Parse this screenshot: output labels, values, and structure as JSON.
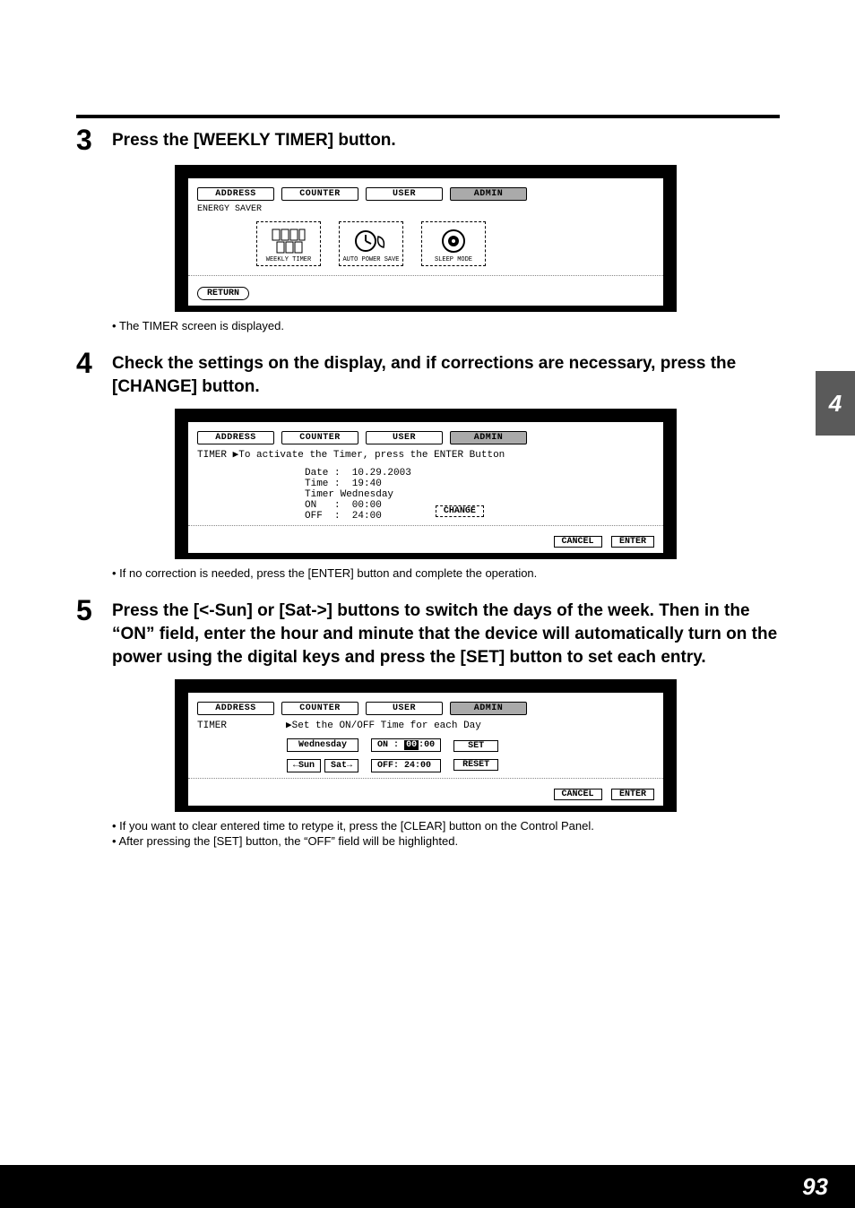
{
  "page_number": "93",
  "side_tab": "4",
  "steps": {
    "s3": {
      "num": "3",
      "title": "Press the [WEEKLY TIMER] button.",
      "bullet1": "The TIMER screen is displayed."
    },
    "s4": {
      "num": "4",
      "title": "Check the settings on the display, and if corrections are necessary, press the [CHANGE] button.",
      "bullet1": "If no correction is needed, press the [ENTER] button and complete the operation."
    },
    "s5": {
      "num": "5",
      "title": "Press the [<-Sun] or [Sat->] buttons to switch the days of the week. Then in the “ON” field, enter the hour and minute that the device will automatically turn on the power using the digital keys and press the [SET] button to set each entry.",
      "bullet1": "If you want to clear entered time to retype it, press the [CLEAR] button on the Control Panel.",
      "bullet2": "After pressing the [SET] button, the “OFF” field will be highlighted."
    }
  },
  "lcd_tabs": {
    "address": "ADDRESS",
    "counter": "COUNTER",
    "user": "USER",
    "admin": "ADMIN"
  },
  "lcd1": {
    "breadcrumb": "ENERGY SAVER",
    "icon1": "WEEKLY TIMER",
    "icon2": "AUTO POWER SAVE",
    "icon3": "SLEEP MODE",
    "return": "RETURN"
  },
  "lcd2": {
    "breadcrumb": "TIMER  ▶To activate the Timer, press the ENTER Button",
    "date_lbl": "Date :  10.29.2003",
    "time_lbl": "Time :  19:40",
    "timer_day": "Timer Wednesday",
    "on": "ON   :  00:00",
    "off": "OFF  :  24:00",
    "change": "CHANGE",
    "cancel": "CANCEL",
    "enter": "ENTER"
  },
  "lcd3": {
    "breadcrumb": "TIMER          ▶Set the ON/OFF Time for each Day",
    "day": "Wednesday",
    "on_label": "ON :",
    "on_hh": "00",
    "on_rest": ":00",
    "off": "OFF: 24:00",
    "sun": "←Sun",
    "sat": "Sat→",
    "set": "SET",
    "reset": "RESET",
    "cancel": "CANCEL",
    "enter": "ENTER"
  }
}
